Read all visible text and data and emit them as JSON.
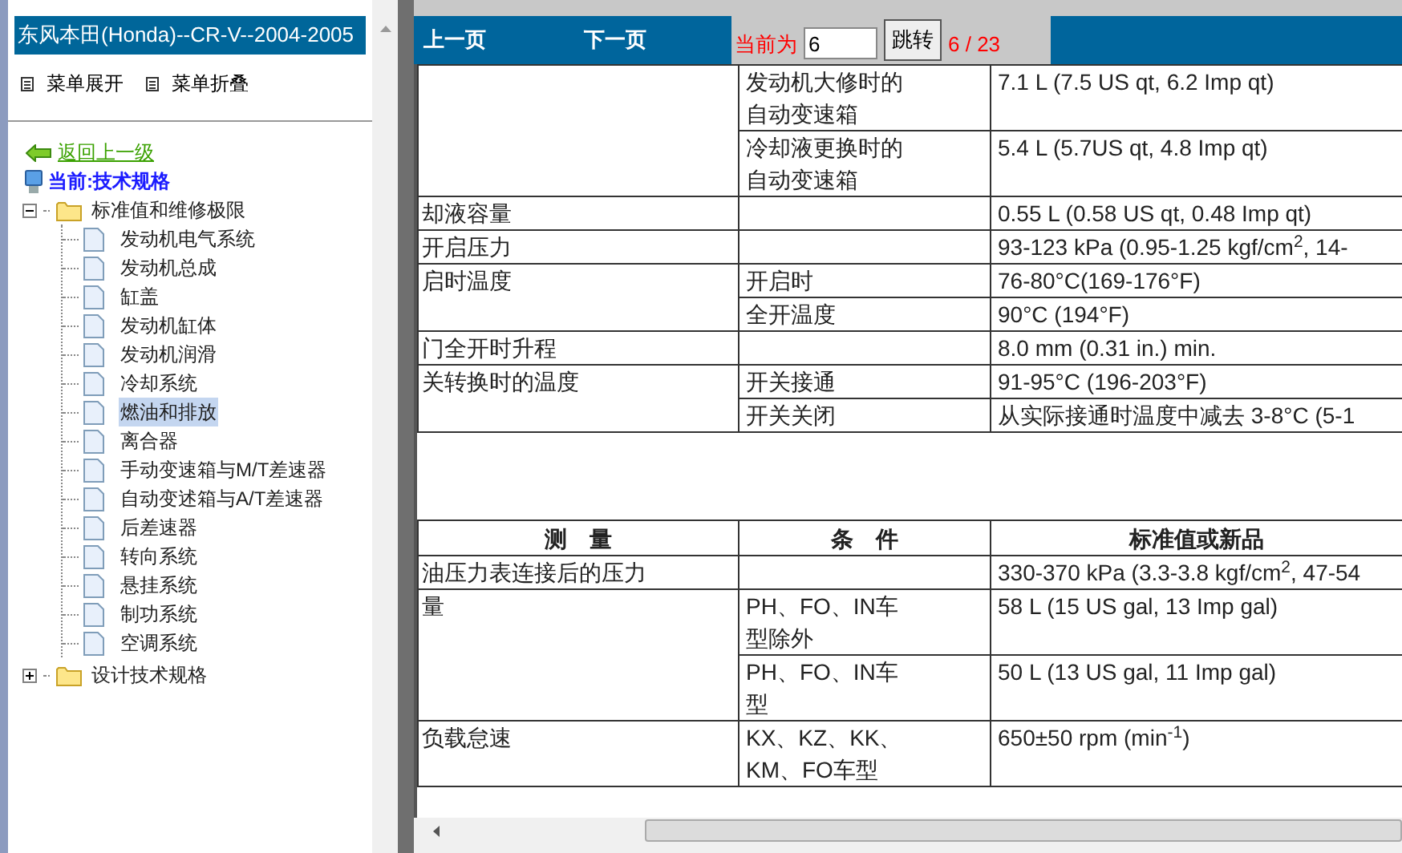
{
  "sidebar": {
    "title": "东风本田(Honda)--CR-V--2004-2005",
    "menu_buttons": [
      "菜单展开",
      "菜单折叠"
    ],
    "back_link": "返回上一级",
    "current": "当前:技术规格",
    "tree": [
      {
        "label": "标准值和维修极限",
        "expanded": true,
        "children": [
          {
            "label": "发动机电气系统",
            "selected": false
          },
          {
            "label": "发动机总成",
            "selected": false
          },
          {
            "label": "缸盖",
            "selected": false
          },
          {
            "label": "发动机缸体",
            "selected": false
          },
          {
            "label": "发动机润滑",
            "selected": false
          },
          {
            "label": "冷却系统",
            "selected": false
          },
          {
            "label": "燃油和排放",
            "selected": true
          },
          {
            "label": "离合器",
            "selected": false
          },
          {
            "label": "手动变速箱与M/T差速器",
            "selected": false
          },
          {
            "label": "自动变述箱与A/T差速器",
            "selected": false
          },
          {
            "label": "后差速器",
            "selected": false
          },
          {
            "label": "转向系统",
            "selected": false
          },
          {
            "label": "悬挂系统",
            "selected": false
          },
          {
            "label": "制功系统",
            "selected": false
          },
          {
            "label": "空调系统",
            "selected": false
          }
        ]
      },
      {
        "label": "设计技术规格",
        "expanded": false
      }
    ]
  },
  "toolbar": {
    "prev": "上一页",
    "next": "下一页",
    "page_label": "当前为",
    "page_value": "6",
    "go_button": "跳转",
    "page_count": "6 / 23"
  },
  "tables": [
    {
      "rows": [
        {
          "measure": "",
          "condition": "发动机大修时的自动变速箱",
          "value": "7.1 L (7.5 US qt, 6.2 Imp qt)"
        },
        {
          "measure": null,
          "condition": "冷却液更换时的自动变速箱",
          "value": "5.4 L (5.7US qt, 4.8 Imp qt)"
        },
        {
          "measure": "却液容量",
          "condition": "",
          "value": "0.55 L (0.58 US qt, 0.48 Imp qt)"
        },
        {
          "measure": "开启压力",
          "condition": "",
          "value": "93-123 kPa (0.95-1.25 kgf/cm$^{2}$, 14-"
        },
        {
          "measure": "启时温度",
          "condition": "开启时",
          "value": "76-80°C(169-176°F)"
        },
        {
          "measure": null,
          "condition": "全开温度",
          "value": "90°C (194°F)"
        },
        {
          "measure": "门全开时升程",
          "condition": "",
          "value": "8.0 mm (0.31 in.) min."
        },
        {
          "measure": "关转换时的温度",
          "condition": "开关接通",
          "value": "91-95°C (196-203°F)"
        },
        {
          "measure": null,
          "condition": "开关关闭",
          "value": "从实际接通时温度中减去 3-8°C (5-1"
        }
      ]
    },
    {
      "header": [
        "测　量",
        "条　件",
        "标准值或新品"
      ],
      "rows": [
        {
          "measure": "油压力表连接后的压力",
          "condition": "",
          "value": "330-370 kPa (3.3-3.8 kgf/cm$^{2}$, 47-54"
        },
        {
          "measure": "量",
          "condition": "PH、FO、IN车型除外",
          "value": "58 L (15 US gal, 13 Imp gal)"
        },
        {
          "measure": null,
          "condition": "PH、FO、IN车型",
          "value": "50 L (13 US gal, 11 Imp gal)"
        },
        {
          "measure": "负载怠速",
          "condition": "KX、KZ、KK、KM、FO车型",
          "value": "650±50 rpm (min$^{-1}$)"
        }
      ]
    }
  ]
}
